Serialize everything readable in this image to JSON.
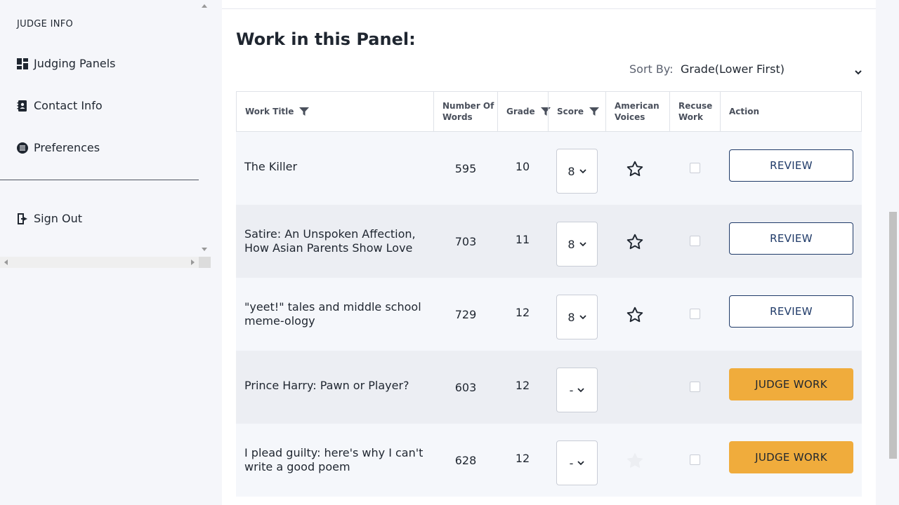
{
  "sidebar": {
    "heading": "JUDGE INFO",
    "items": [
      {
        "label": "Judging Panels",
        "icon": "dashboard-icon"
      },
      {
        "label": "Contact Info",
        "icon": "contact-book-icon"
      },
      {
        "label": "Preferences",
        "icon": "preferences-icon"
      }
    ],
    "signout": {
      "label": "Sign Out",
      "icon": "sign-out-icon"
    }
  },
  "main": {
    "title": "Work in this Panel:",
    "sort": {
      "label": "Sort By:",
      "value": "Grade(Lower First)"
    },
    "columns": {
      "work_title": "Work Title",
      "num_words_1": "Number Of",
      "num_words_2": "Words",
      "grade": "Grade",
      "score": "Score",
      "american_1": "American",
      "american_2": "Voices",
      "recuse_1": "Recuse",
      "recuse_2": "Work",
      "action": "Action"
    },
    "rows": [
      {
        "title_1": "The Killer",
        "title_2": "",
        "words": "595",
        "grade": "10",
        "score": "8",
        "starred": "outline",
        "action": "REVIEW",
        "action_type": "review"
      },
      {
        "title_1": "Satire: An Unspoken Affection,",
        "title_2": "How Asian Parents Show Love",
        "words": "703",
        "grade": "11",
        "score": "8",
        "starred": "outline",
        "action": "REVIEW",
        "action_type": "review"
      },
      {
        "title_1": "\"yeet!\" tales and middle school",
        "title_2": "meme-ology",
        "words": "729",
        "grade": "12",
        "score": "8",
        "starred": "outline",
        "action": "REVIEW",
        "action_type": "review"
      },
      {
        "title_1": "Prince Harry: Pawn or Player?",
        "title_2": "",
        "words": "603",
        "grade": "12",
        "score": "-",
        "starred": "disabled",
        "action": "JUDGE WORK",
        "action_type": "judge"
      },
      {
        "title_1": "I plead guilty: here's why I can't",
        "title_2": "write a good poem",
        "words": "628",
        "grade": "12",
        "score": "-",
        "starred": "disabled",
        "action": "JUDGE WORK",
        "action_type": "judge"
      }
    ]
  },
  "colors": {
    "accent_orange": "#f0ac3c",
    "review_navy": "#1f3a68",
    "background": "#f5f6fa"
  }
}
